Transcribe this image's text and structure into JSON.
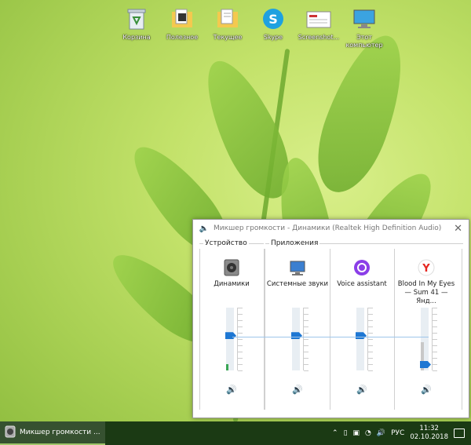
{
  "desktop": {
    "icons": [
      {
        "label": "Корзина",
        "icon": "recycle-bin-icon"
      },
      {
        "label": "Полезное",
        "icon": "folder-icon"
      },
      {
        "label": "Текущее",
        "icon": "folder-icon"
      },
      {
        "label": "Skype",
        "icon": "skype-icon"
      },
      {
        "label": "Screenshot...",
        "icon": "document-icon"
      },
      {
        "label": "Этот компьютер",
        "icon": "computer-icon"
      }
    ]
  },
  "mixer": {
    "title": "Микшер громкости - Динамики (Realtek High Definition Audio)",
    "device_label": "Устройство",
    "apps_label": "Приложения",
    "columns": [
      {
        "name": "Динамики",
        "icon": "speaker-device-icon",
        "level_percent": 56,
        "meter_percent": 10
      },
      {
        "name": "Системные звуки",
        "icon": "system-sounds-icon",
        "level_percent": 56,
        "meter_percent": 0
      },
      {
        "name": "Voice assistant",
        "icon": "alice-icon",
        "level_percent": 56,
        "meter_percent": 0
      },
      {
        "name": "Blood In My Eyes — Sum 41 — Янд...",
        "icon": "yandex-browser-icon",
        "level_percent": 10,
        "meter_percent": 45
      }
    ]
  },
  "taskbar": {
    "active_window": "Микшер громкости ...",
    "language": "РУС",
    "time": "11:32",
    "date": "02.10.2018"
  },
  "colors": {
    "accent": "#1e77d3",
    "taskbar": "#1b3a14"
  }
}
